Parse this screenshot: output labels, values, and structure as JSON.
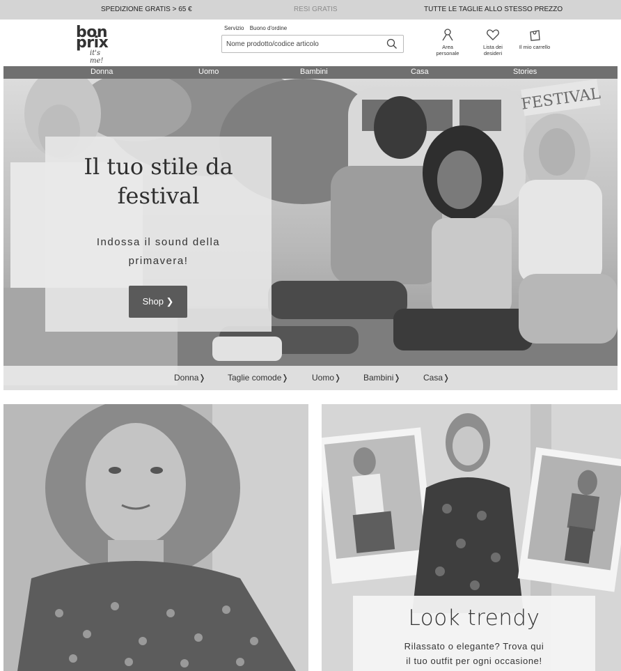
{
  "promo_bar": {
    "shipping": "SPEDIZIONE GRATIS > 65 €",
    "returns": "RESI GRATIS",
    "sizes": "TUTTE LE TAGLIE ALLO STESSO PREZZO"
  },
  "header": {
    "logo": {
      "line1": "bon",
      "line2": "prix",
      "tagline": "it's me!"
    },
    "service_link": "Servizio",
    "voucher_link": "Buono d'ordine",
    "search_placeholder": "Nome prodotto/codice articolo",
    "account_label_1": "Area",
    "account_label_2": "personale",
    "wishlist_label_1": "Lista dei",
    "wishlist_label_2": "desideri",
    "cart_label": "Il mio carrello"
  },
  "nav": {
    "items": [
      "Donna",
      "Uomo",
      "Bambini",
      "Casa",
      "Stories"
    ]
  },
  "hero": {
    "title_line1": "Il tuo stile da",
    "title_line2": "festival",
    "subtitle_line1": "Indossa il sound della",
    "subtitle_line2": "primavera!",
    "button_label": "Shop ❯",
    "links": [
      "Donna❭",
      "Taglie comode❭",
      "Uomo❭",
      "Bambini❭",
      "Casa❭"
    ]
  },
  "look_trendy": {
    "title": "Look trendy",
    "line1": "Rilassato o elegante? Trova qui",
    "line2": "il tuo outfit per ogni occasione!"
  },
  "colors": {
    "promo_bg": "#d4d4d4",
    "nav_bg": "#707070",
    "button_bg": "#5a5a5a"
  }
}
